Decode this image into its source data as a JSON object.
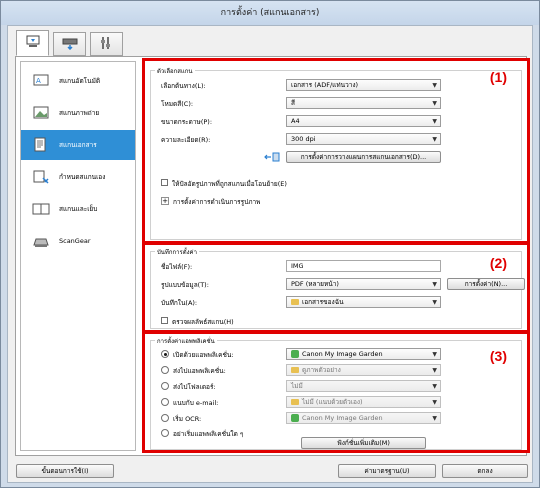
{
  "window": {
    "title": "การตั้งค่า (สแกนเอกสาร)"
  },
  "tabs": [
    {
      "icon": "scan-from-computer-icon"
    },
    {
      "icon": "scan-from-panel-icon"
    },
    {
      "icon": "general-settings-icon"
    }
  ],
  "sidebar": {
    "items": [
      {
        "label": "สแกนอัตโนมัติ",
        "icon": "auto-scan-icon"
      },
      {
        "label": "สแกนภาพถ่าย",
        "icon": "photo-scan-icon"
      },
      {
        "label": "สแกนเอกสาร",
        "icon": "document-scan-icon",
        "active": true
      },
      {
        "label": "กำหนดสแกนเอง",
        "icon": "custom-scan-icon"
      },
      {
        "label": "สแกนและเย็บ",
        "icon": "scan-and-stitch-icon"
      },
      {
        "label": "ScanGear",
        "icon": "scangear-icon"
      }
    ]
  },
  "scan_options": {
    "group_title": "ตัวเลือกสแกน",
    "number": "(1)",
    "source_label": "เลือกต้นทาง(L):",
    "source_value": "เอกสาร (ADF/แท่นวาง)",
    "color_mode_label": "โหมดสี(C):",
    "color_mode_value": "สี",
    "paper_size_label": "ขนาดกระดาษ(P):",
    "paper_size_value": "A4",
    "resolution_label": "ความละเอียด(R):",
    "resolution_value": "300 dpi",
    "duplex_button": "การตั้งค่าการวางแผนการสแกนเอกสาร(D)...",
    "photo_check_label": "ให้ปัลอัตรูปภาพที่ถูกสแกนเมื่อโอนย้าย(E)",
    "image_processing_label": "การตั้งค่าการดำเนินการรูปภาพ"
  },
  "save_settings": {
    "group_title": "บันทึกการตั้งค่า",
    "number": "(2)",
    "filename_label": "ชื่อไฟล์(F):",
    "filename_value": "IMG",
    "data_format_label": "รูปแบบข้อมูล(T):",
    "data_format_value": "PDF (หลายหน้า)",
    "settings_button": "การตั้งค่า(N)...",
    "save_in_label": "บันทึกใน(A):",
    "save_in_value": "เอกสารของฉัน",
    "check_results_label": "ตรวจผลลัพธ์สแกน(H)"
  },
  "app_settings": {
    "group_title": "การตั้งค่าแอพพลิเคชั่น",
    "number": "(3)",
    "options": [
      {
        "label": "เปิดด้วยแอพพลิเคชั่น:",
        "value": "Canon My Image Garden",
        "selected": true,
        "icon": "garden",
        "disabled": false
      },
      {
        "label": "ส่งไปแอพพลิเคชั่น:",
        "value": "ดูภาพตัวอย่าง",
        "selected": false,
        "icon": "folder",
        "disabled": true
      },
      {
        "label": "ส่งไปโฟลเดอร์:",
        "value": "ไม่มี",
        "selected": false,
        "icon": "",
        "disabled": true
      },
      {
        "label": "แนบกับ e-mail:",
        "value": "ไม่มี (แนบด้วยตัวเอง)",
        "selected": false,
        "icon": "folder",
        "disabled": true
      },
      {
        "label": "เริ่ม OCR:",
        "value": "Canon My Image Garden",
        "selected": false,
        "icon": "garden",
        "disabled": true
      },
      {
        "label": "อย่าเริ่มแอพพลิเคชั่นใด ๆ",
        "value": "",
        "selected": false,
        "icon": "",
        "disabled": false
      }
    ],
    "more_functions_button": "ฟังก์ชั่นเพิ่มเติม(M)"
  },
  "footer": {
    "instructions_button": "ขั้นตอนการใช้(I)",
    "defaults_button": "ค่ามาตรฐาน(U)",
    "ok_button": "ตกลง"
  }
}
